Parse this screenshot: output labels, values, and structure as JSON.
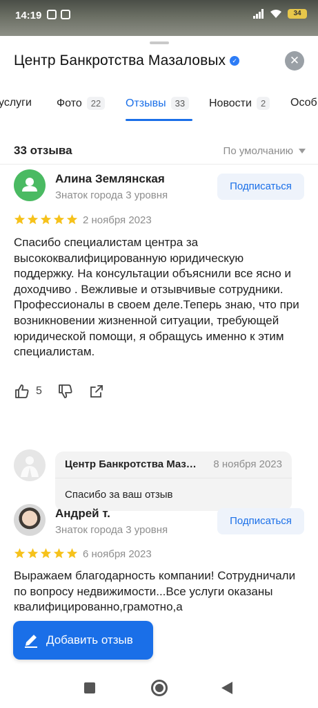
{
  "status_bar": {
    "time": "14:19",
    "battery": "34"
  },
  "header": {
    "title": "Центр Банкротства Мазаловых"
  },
  "tabs": [
    {
      "label": "услуги",
      "count": ""
    },
    {
      "label": "Фото",
      "count": "22"
    },
    {
      "label": "Отзывы",
      "count": "33"
    },
    {
      "label": "Новости",
      "count": "2"
    },
    {
      "label": "Особ",
      "count": ""
    }
  ],
  "reviews_header": {
    "count_label": "33 отзыва",
    "sort_label": "По умолчанию"
  },
  "reviews": [
    {
      "author": "Алина Землянская",
      "level": "Знаток города 3 уровня",
      "subscribe_label": "Подписаться",
      "rating": 5,
      "date": "2 ноября 2023",
      "text": "Спасибо специалистам центра за высококвалифицированную юридическую поддержку. На консультации объяснили все ясно и доходчиво . Вежливые и отзывчивые сотрудники. Профессионалы в своем деле.Теперь знаю, что при возникновении жизненной ситуации, требующей юридической помощи, я обращусь именно к этим специалистам.",
      "likes": "5",
      "reply": {
        "name": "Центр Банкротства Мазаловых",
        "date": "8 ноября 2023",
        "text": "Спасибо за ваш отзыв"
      }
    },
    {
      "author": "Андрей т.",
      "level": "Знаток города 3 уровня",
      "subscribe_label": "Подписаться",
      "rating": 5,
      "date": "6 ноября 2023",
      "text": "Выражаем благодарность компании! Сотрудничали по вопросу недвижимости...Все услуги оказаны квалифицированно,грамотно,а"
    }
  ],
  "add_review_label": "Добавить отзыв",
  "colors": {
    "accent": "#1a6fe8",
    "star": "#f6c21c",
    "avatar_green": "#4aba62"
  }
}
